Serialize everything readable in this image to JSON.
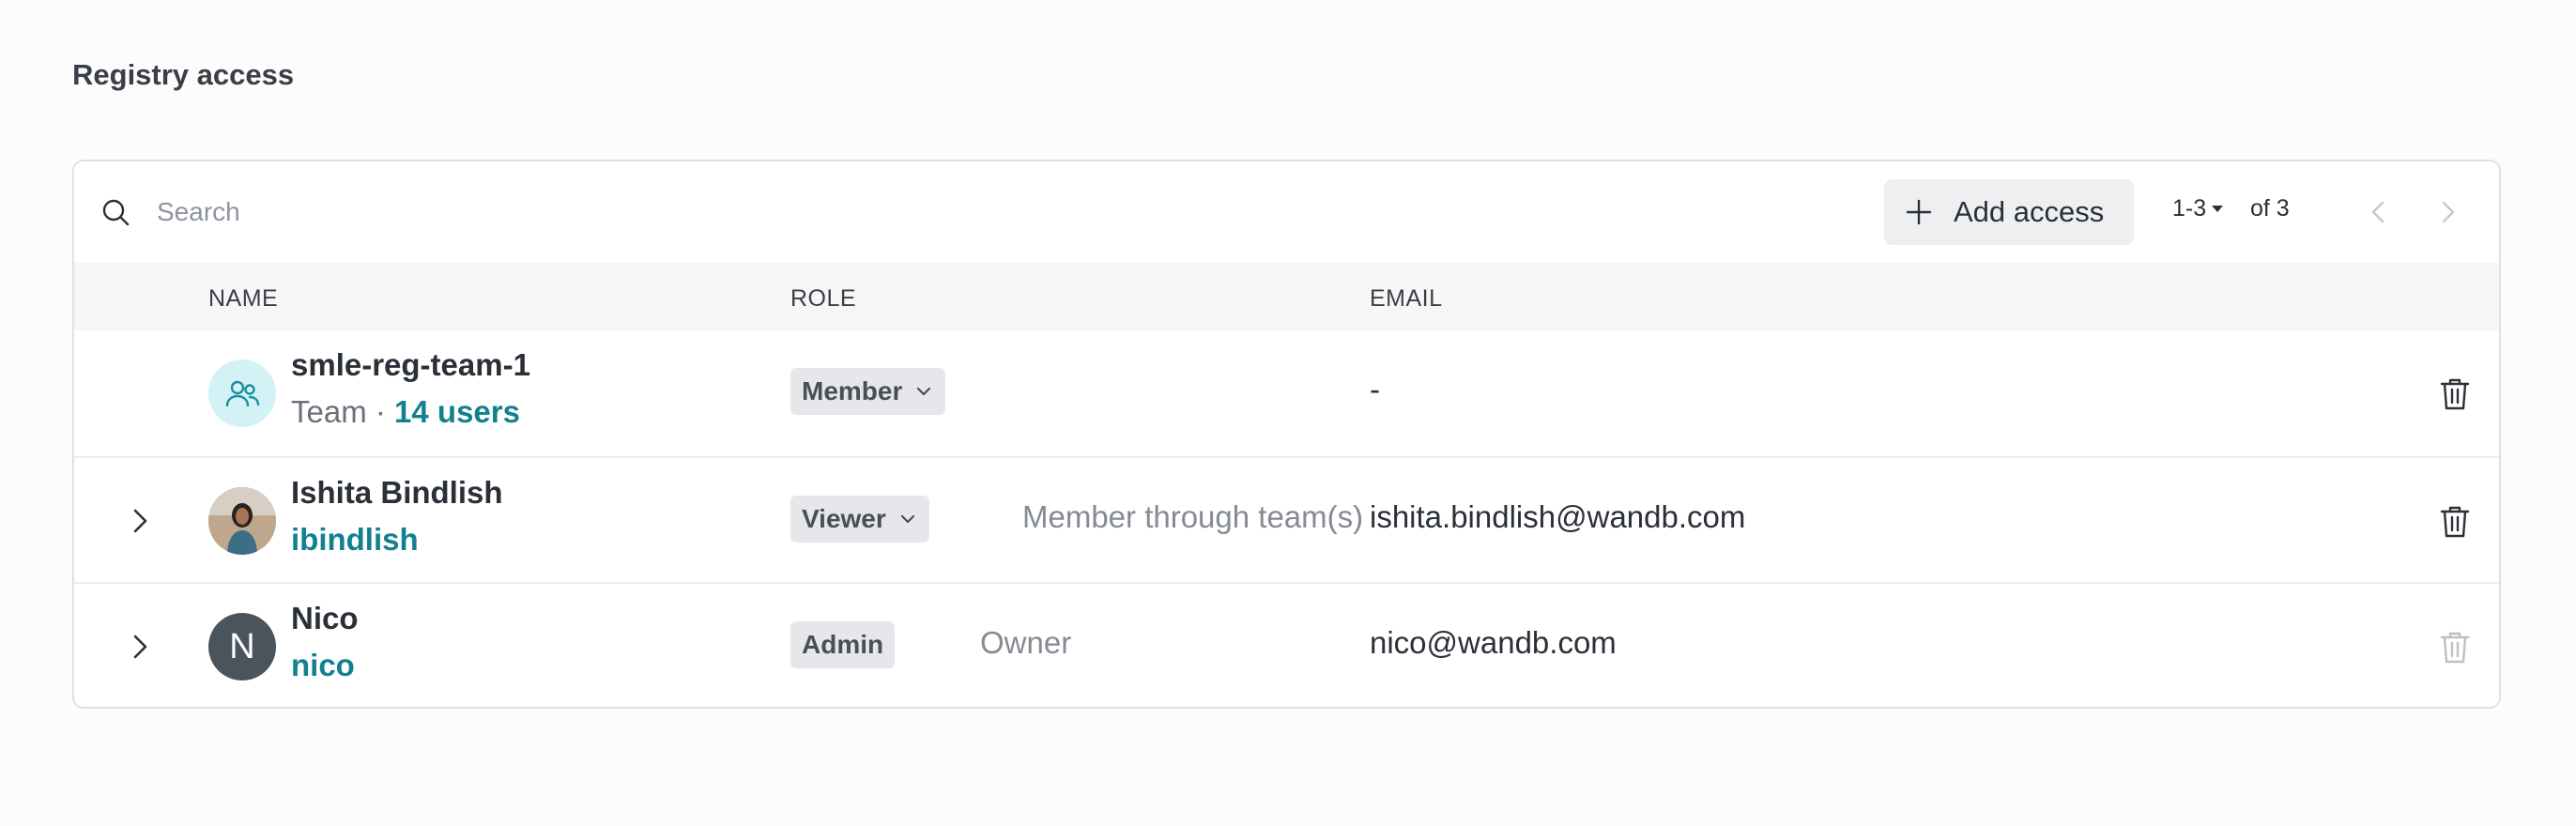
{
  "page": {
    "title": "Registry access"
  },
  "toolbar": {
    "search_placeholder": "Search",
    "add_access_label": "Add access",
    "pager_range": "1-3",
    "pager_total": "of 3"
  },
  "columns": {
    "name": "NAME",
    "role": "ROLE",
    "email": "EMAIL"
  },
  "rows": [
    {
      "name": "smle-reg-team-1",
      "sub_prefix": "Team · ",
      "sub_link": "14 users",
      "role": "Member",
      "role_note": "",
      "email": "-",
      "avatar": "team-icon",
      "expandable": false,
      "delete_enabled": true
    },
    {
      "name": "Ishita Bindlish",
      "sub_prefix": "",
      "sub_link": "ibindlish",
      "role": "Viewer",
      "role_note": "Member through team(s)",
      "email": "ishita.bindlish@wandb.com",
      "avatar": "user-photo",
      "expandable": true,
      "delete_enabled": true
    },
    {
      "name": "Nico",
      "sub_prefix": "",
      "sub_link": "nico",
      "role": "Admin",
      "role_note": "Owner",
      "email": "nico@wandb.com",
      "avatar_initial": "N",
      "expandable": true,
      "delete_enabled": false
    }
  ],
  "colors": {
    "link": "#12808f",
    "team_avatar_bg": "#d3f2f6",
    "initial_avatar_bg": "#49545d",
    "chip_bg": "#e6e7ea"
  }
}
